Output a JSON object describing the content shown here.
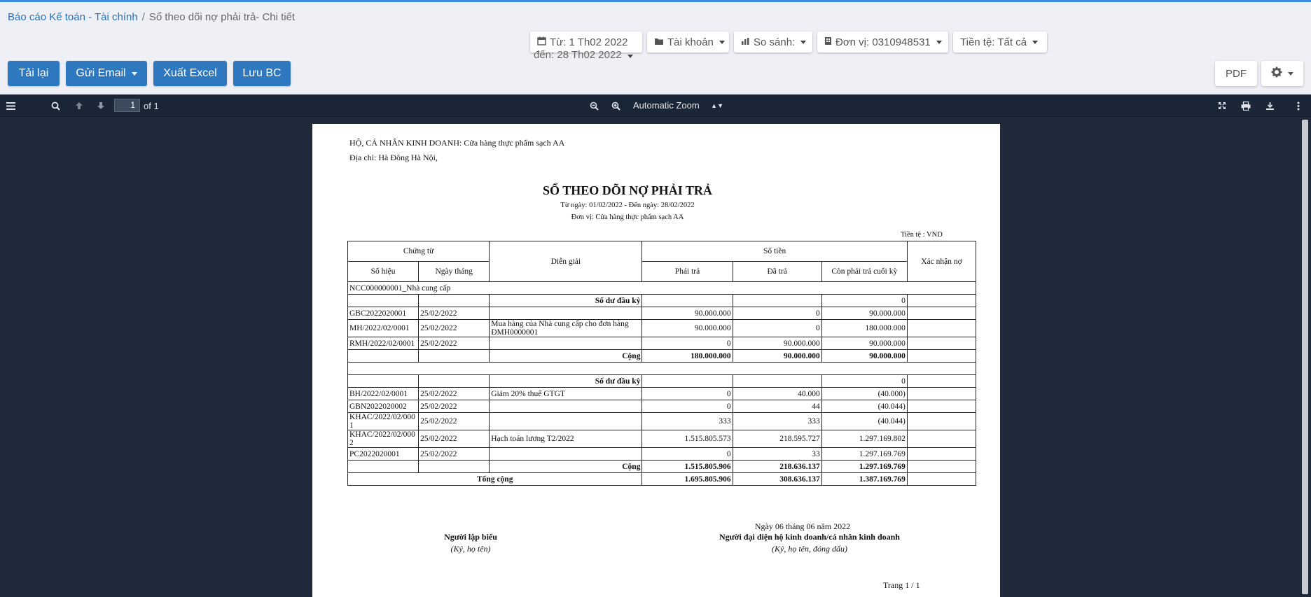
{
  "breadcrumb": {
    "parent": "Báo cáo Kế toán - Tài chính",
    "separator": "/",
    "current": "Sổ theo dõi nợ phải trả- Chi tiết"
  },
  "filters": {
    "date_from": "Từ: 1 Th02 2022",
    "date_to": "đến: 28 Th02 2022",
    "account": "Tài khoản",
    "compare": "So sánh:",
    "unit": "Đơn vị: 0310948531",
    "currency": "Tiền tệ: Tất cả"
  },
  "actions": {
    "reload": "Tải lại",
    "send_email": "Gửi Email",
    "export_excel": "Xuất Excel",
    "save_report": "Lưu BC",
    "pdf": "PDF"
  },
  "viewer": {
    "page_number": "1",
    "page_count": "of 1",
    "zoom": "Automatic Zoom"
  },
  "report": {
    "business_label": "HỘ, CÁ NHÂN KINH DOANH:",
    "business_name": "Cửa hàng thực phẩm sạch AA",
    "address": "Địa chỉ: Hà Đông Hà Nội,",
    "title": "SỔ THEO DÕI NỢ PHẢI TRẢ",
    "period": "Từ ngày: 01/02/2022 - Đến ngày: 28/02/2022",
    "unit": "Đơn vị: Cửa hàng thực phẩm sạch AA",
    "currency": "Tiền tệ : VND",
    "headers": {
      "voucher": "Chứng từ",
      "voucher_no": "Số hiệu",
      "voucher_date": "Ngày tháng",
      "description": "Diễn giải",
      "amount": "Số tiền",
      "payable": "Phải trả",
      "paid": "Đã trả",
      "remaining": "Còn phải trả cuối kỳ",
      "confirm": "Xác nhận nợ"
    },
    "group1": {
      "name": "NCC000000001_Nhà cung cấp",
      "opening_label": "Số dư đầu kỳ",
      "opening_value": "0",
      "rows": [
        {
          "no": "GBC2022020001",
          "date": "25/02/2022",
          "desc": "",
          "payable": "90.000.000",
          "paid": "0",
          "remaining": "90.000.000"
        },
        {
          "no": "MH/2022/02/0001",
          "date": "25/02/2022",
          "desc": "Mua hàng của Nhà cung cấp cho đơn hàng ĐMH0000001",
          "payable": "90.000.000",
          "paid": "0",
          "remaining": "180.000.000"
        },
        {
          "no": "RMH/2022/02/0001",
          "date": "25/02/2022",
          "desc": "",
          "payable": "0",
          "paid": "90.000.000",
          "remaining": "90.000.000"
        }
      ],
      "total_label": "Cộng",
      "total_payable": "180.000.000",
      "total_paid": "90.000.000",
      "total_remaining": "90.000.000"
    },
    "group2": {
      "opening_label": "Số dư đầu kỳ",
      "opening_value": "0",
      "rows": [
        {
          "no": "BH/2022/02/0001",
          "date": "25/02/2022",
          "desc": "Giảm 20% thuế GTGT",
          "payable": "0",
          "paid": "40.000",
          "remaining": "(40.000)"
        },
        {
          "no": "GBN2022020002",
          "date": "25/02/2022",
          "desc": "",
          "payable": "0",
          "paid": "44",
          "remaining": "(40.044)"
        },
        {
          "no": "KHAC/2022/02/0001",
          "date": "25/02/2022",
          "desc": "",
          "payable": "333",
          "paid": "333",
          "remaining": "(40.044)"
        },
        {
          "no": "KHAC/2022/02/0002",
          "date": "25/02/2022",
          "desc": "Hạch toán lương T2/2022",
          "payable": "1.515.805.573",
          "paid": "218.595.727",
          "remaining": "1.297.169.802"
        },
        {
          "no": "PC2022020001",
          "date": "25/02/2022",
          "desc": "",
          "payable": "0",
          "paid": "33",
          "remaining": "1.297.169.769"
        }
      ],
      "total_label": "Cộng",
      "total_payable": "1.515.805.906",
      "total_paid": "218.636.137",
      "total_remaining": "1.297.169.769"
    },
    "grand_total_label": "Tổng cộng",
    "grand_total_payable": "1.695.805.906",
    "grand_total_paid": "308.636.137",
    "grand_total_remaining": "1.387.169.769",
    "sign_date": "Ngày 06 tháng 06 năm 2022",
    "preparer_title": "Người lập biểu",
    "preparer_note": "(Ký, họ tên)",
    "representative_title": "Người đại diện hộ kinh doanh/cá nhân kinh doanh",
    "representative_note": "(Ký, họ tên, đóng dấu)",
    "page_footer": "Trang 1 /  1"
  },
  "icons": [
    "calendar-icon",
    "folder-icon",
    "building-icon",
    "gear-icon",
    "sidebar-toggle-icon",
    "search-icon",
    "arrow-up-icon",
    "arrow-down-icon",
    "zoom-out-icon",
    "zoom-in-icon",
    "fullscreen-icon",
    "print-icon",
    "download-icon",
    "more-icon"
  ],
  "colors": {
    "primary": "#2e78c0",
    "link": "#2a6fb6",
    "viewer_bg": "#1f2a3a",
    "accent_bar": "#3a8ee6"
  }
}
